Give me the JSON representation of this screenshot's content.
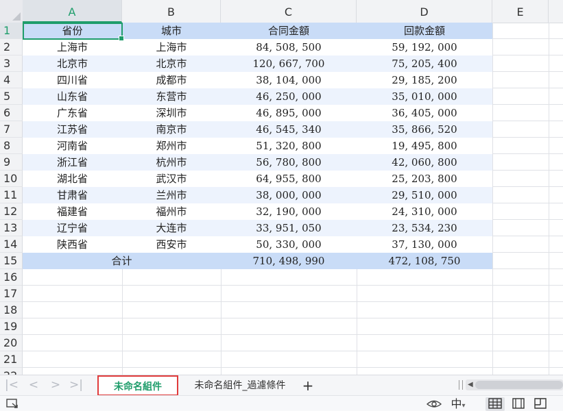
{
  "columns": [
    "A",
    "B",
    "C",
    "D",
    "E"
  ],
  "selected_column": "A",
  "row_numbers": [
    "1",
    "2",
    "3",
    "4",
    "5",
    "6",
    "7",
    "8",
    "9",
    "10",
    "11",
    "12",
    "13",
    "14",
    "15",
    "16",
    "17",
    "18",
    "19",
    "20",
    "21",
    "22"
  ],
  "table": {
    "headers": [
      "省份",
      "城市",
      "合同金額",
      "回款金額"
    ],
    "rows": [
      [
        "上海市",
        "上海市",
        "84, 508, 500",
        "59, 192, 000"
      ],
      [
        "北京市",
        "北京市",
        "120, 667, 700",
        "75, 205, 400"
      ],
      [
        "四川省",
        "成都市",
        "38, 104, 000",
        "29, 185, 200"
      ],
      [
        "山东省",
        "东营市",
        "46, 250, 000",
        "35, 010, 000"
      ],
      [
        "广东省",
        "深圳市",
        "46, 895, 000",
        "36, 405, 000"
      ],
      [
        "江苏省",
        "南京市",
        "46, 545, 340",
        "35, 866, 520"
      ],
      [
        "河南省",
        "郑州市",
        "51, 320, 800",
        "19, 495, 800"
      ],
      [
        "浙江省",
        "杭州市",
        "56, 780, 800",
        "42, 060, 800"
      ],
      [
        "湖北省",
        "武汉市",
        "64, 955, 800",
        "25, 203, 800"
      ],
      [
        "甘肃省",
        "兰州市",
        "38, 000, 000",
        "29, 510, 000"
      ],
      [
        "福建省",
        "福州市",
        "32, 190, 000",
        "24, 310, 000"
      ],
      [
        "辽宁省",
        "大连市",
        "33, 951, 050",
        "23, 534, 230"
      ],
      [
        "陕西省",
        "西安市",
        "50, 330, 000",
        "37, 130, 000"
      ]
    ],
    "total": {
      "label": "合计",
      "contract": "710, 498, 990",
      "received": "472, 108, 750"
    }
  },
  "tabs": [
    {
      "label": "未命名組件",
      "active": true
    },
    {
      "label": "未命名組件_過濾條件",
      "active": false
    }
  ],
  "tab_nav": {
    "first": "|<",
    "prev": "<",
    "next": ">",
    "last": ">|",
    "add": "+"
  },
  "status": {
    "view_icon": "eye-icon",
    "ime_label": "中",
    "ime_arrow": "▾",
    "views": [
      "normal-view-icon",
      "page-layout-icon",
      "page-break-icon"
    ]
  },
  "colors": {
    "header_band": "#c9dcf7",
    "stripe": "#edf3fd",
    "selection": "#1f9d6b",
    "active_tab_border": "#e03b3b"
  }
}
